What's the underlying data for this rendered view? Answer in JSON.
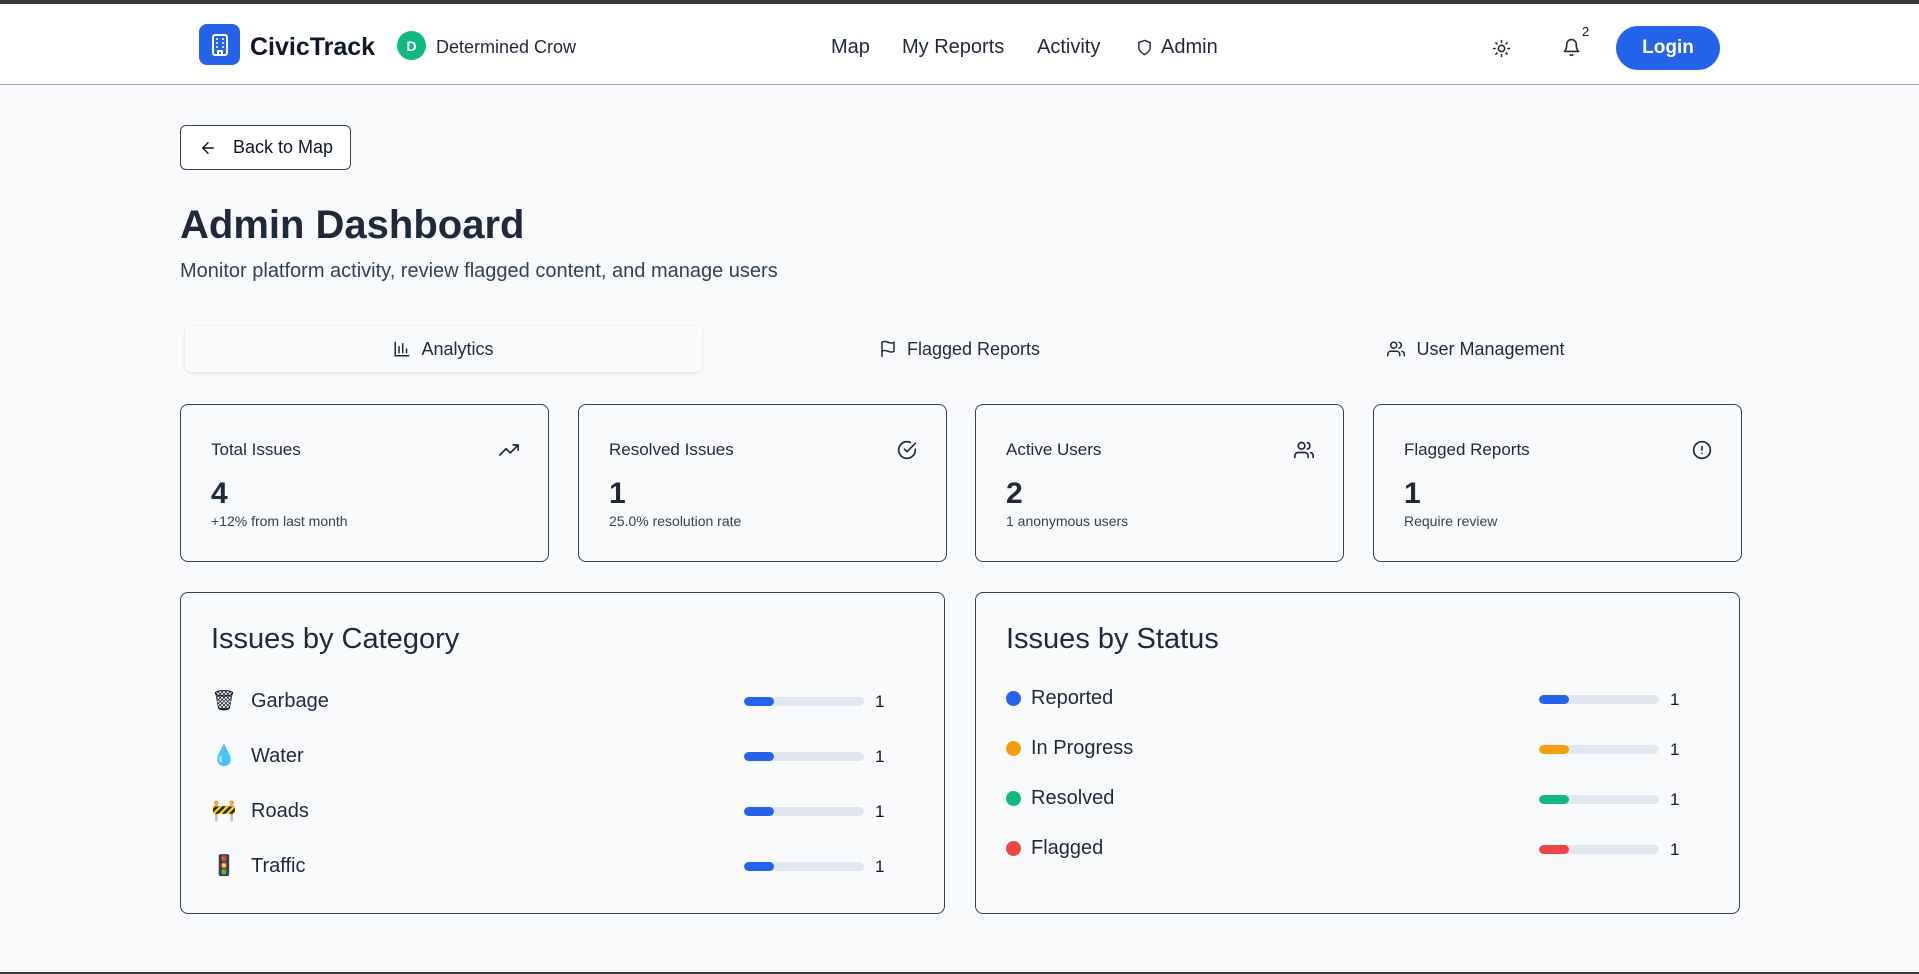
{
  "header": {
    "brand": "CivicTrack",
    "user": {
      "initial": "D",
      "name": "Determined Crow",
      "avatar_color": "#10b981"
    },
    "nav": [
      "Map",
      "My Reports",
      "Activity",
      "Admin"
    ],
    "notifications_count": "2",
    "login_label": "Login",
    "accent": "#2563eb"
  },
  "back_label": "Back to Map",
  "page": {
    "title": "Admin Dashboard",
    "subtitle": "Monitor platform activity, review flagged content, and manage users"
  },
  "tabs": [
    {
      "label": "Analytics",
      "icon": "bar-chart-icon",
      "active": true
    },
    {
      "label": "Flagged Reports",
      "icon": "flag-icon",
      "active": false
    },
    {
      "label": "User Management",
      "icon": "users-icon",
      "active": false
    }
  ],
  "stats": [
    {
      "title": "Total Issues",
      "value": "4",
      "sub": "+12% from last month",
      "icon": "trending-up-icon"
    },
    {
      "title": "Resolved Issues",
      "value": "1",
      "sub": "25.0% resolution rate",
      "icon": "check-circle-icon"
    },
    {
      "title": "Active Users",
      "value": "2",
      "sub": "1 anonymous users",
      "icon": "users-icon"
    },
    {
      "title": "Flagged Reports",
      "value": "1",
      "sub": "Require review",
      "icon": "alert-circle-icon"
    }
  ],
  "category_panel": {
    "title": "Issues by Category",
    "items": [
      {
        "label": "Garbage",
        "icon": "🗑",
        "icon_name": "wastebasket-icon",
        "count": "1",
        "fraction": 0.25,
        "color": "#2563eb"
      },
      {
        "label": "Water",
        "icon": "💧",
        "icon_name": "droplet-icon",
        "count": "1",
        "fraction": 0.25,
        "color": "#2563eb"
      },
      {
        "label": "Roads",
        "icon": "🚧",
        "icon_name": "construction-icon",
        "count": "1",
        "fraction": 0.25,
        "color": "#2563eb"
      },
      {
        "label": "Traffic",
        "icon": "🚦",
        "icon_name": "traffic-light-icon",
        "count": "1",
        "fraction": 0.25,
        "color": "#2563eb"
      }
    ]
  },
  "status_panel": {
    "title": "Issues by Status",
    "items": [
      {
        "label": "Reported",
        "count": "1",
        "fraction": 0.25,
        "color": "#2563eb"
      },
      {
        "label": "In Progress",
        "count": "1",
        "fraction": 0.25,
        "color": "#f59e0b"
      },
      {
        "label": "Resolved",
        "count": "1",
        "fraction": 0.25,
        "color": "#10b981"
      },
      {
        "label": "Flagged",
        "count": "1",
        "fraction": 0.25,
        "color": "#ef4444"
      }
    ]
  }
}
